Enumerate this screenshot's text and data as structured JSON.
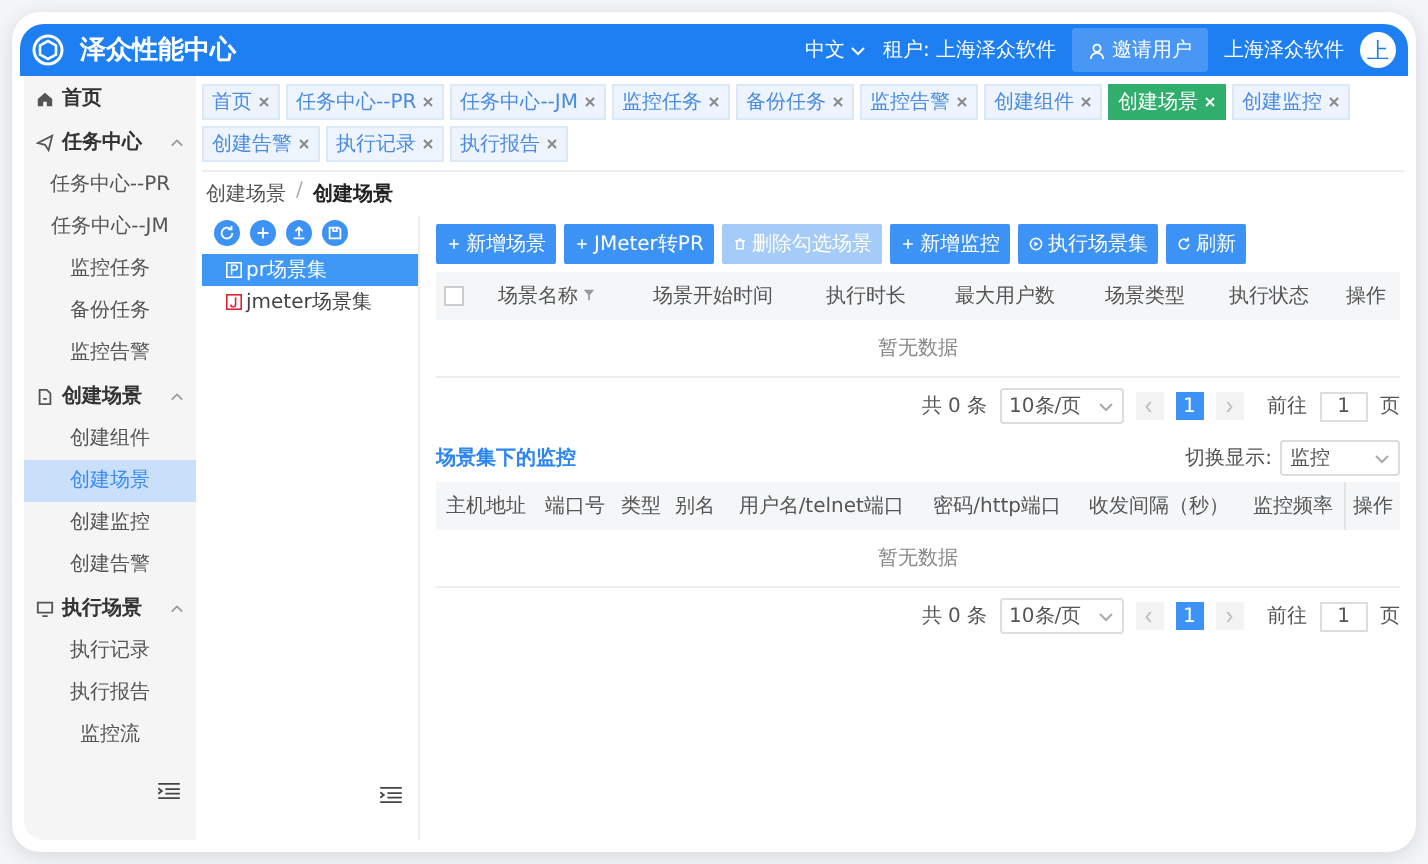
{
  "app": {
    "logo_text": "泽众性能中心",
    "language": "中文",
    "tenant": "租户: 上海泽众软件",
    "invite_button": "邀请用户",
    "user_name": "上海泽众软件",
    "avatar_text": "上"
  },
  "sidebar": {
    "items": [
      {
        "label": "首页",
        "kind": "home"
      },
      {
        "label": "任务中心",
        "kind": "send",
        "expanded": true,
        "children": [
          {
            "label": "任务中心--PR",
            "selected": false
          },
          {
            "label": "任务中心--JM",
            "selected": false
          },
          {
            "label": "监控任务",
            "selected": false
          },
          {
            "label": "备份任务",
            "selected": false
          },
          {
            "label": "监控告警",
            "selected": false
          }
        ]
      },
      {
        "label": "创建场景",
        "kind": "doc",
        "expanded": true,
        "children": [
          {
            "label": "创建组件",
            "selected": false
          },
          {
            "label": "创建场景",
            "selected": true
          },
          {
            "label": "创建监控",
            "selected": false
          },
          {
            "label": "创建告警",
            "selected": false
          }
        ]
      },
      {
        "label": "执行场景",
        "kind": "monitor",
        "expanded": true,
        "children": [
          {
            "label": "执行记录",
            "selected": false
          },
          {
            "label": "执行报告",
            "selected": false
          },
          {
            "label": "监控流",
            "selected": false
          }
        ]
      }
    ]
  },
  "tabs": [
    {
      "label": "首页",
      "selected": false
    },
    {
      "label": "任务中心--PR",
      "selected": false
    },
    {
      "label": "任务中心--JM",
      "selected": false
    },
    {
      "label": "监控任务",
      "selected": false
    },
    {
      "label": "备份任务",
      "selected": false
    },
    {
      "label": "监控告警",
      "selected": false
    },
    {
      "label": "创建组件",
      "selected": false
    },
    {
      "label": "创建场景",
      "selected": true
    },
    {
      "label": "创建监控",
      "selected": false
    },
    {
      "label": "创建告警",
      "selected": false
    },
    {
      "label": "执行记录",
      "selected": false
    },
    {
      "label": "执行报告",
      "selected": false
    }
  ],
  "breadcrumb": [
    "创建场景",
    "创建场景"
  ],
  "breadcrumb_separator": "/",
  "tree": {
    "items": [
      {
        "label": "pr场景集",
        "kind": "pr",
        "selected": true
      },
      {
        "label": "jmeter场景集",
        "kind": "jmeter",
        "selected": false
      }
    ]
  },
  "toolbar_buttons": [
    {
      "label": "新增场景",
      "kind": "plus",
      "disabled": false
    },
    {
      "label": "JMeter转PR",
      "kind": "plus",
      "disabled": false
    },
    {
      "label": "删除勾选场景",
      "kind": "delete",
      "disabled": true
    },
    {
      "label": "新增监控",
      "kind": "plus",
      "disabled": false
    },
    {
      "label": "执行场景集",
      "kind": "run",
      "disabled": false
    },
    {
      "label": "刷新",
      "kind": "refresh",
      "disabled": false
    }
  ],
  "scenario_table": {
    "select_all": {
      "checked": false
    },
    "columns": [
      "场景名称",
      "场景开始时间",
      "执行时长",
      "最大用户数",
      "场景类型",
      "执行状态",
      "操作"
    ],
    "empty_text": "暂无数据",
    "pagination": {
      "total": "共 0 条",
      "page_size": "10条/页",
      "pages": [
        {
          "label": "1",
          "selected": true
        }
      ],
      "goto_label": "前往",
      "goto_value": "1",
      "goto_unit": "页"
    }
  },
  "monitor_section": {
    "title": "场景集下的监控",
    "switch_label": "切换显示:",
    "switch_value": "监控",
    "table": {
      "columns": [
        "主机地址",
        "端口号",
        "类型",
        "别名",
        "用户名/telnet端口",
        "密码/http端口",
        "收发间隔（秒）",
        "监控频率",
        "操作"
      ],
      "empty_text": "暂无数据",
      "pagination": {
        "total": "共 0 条",
        "page_size": "10条/页",
        "pages": [
          {
            "label": "1",
            "selected": true
          }
        ],
        "goto_label": "前往",
        "goto_value": "1",
        "goto_unit": "页"
      }
    }
  }
}
